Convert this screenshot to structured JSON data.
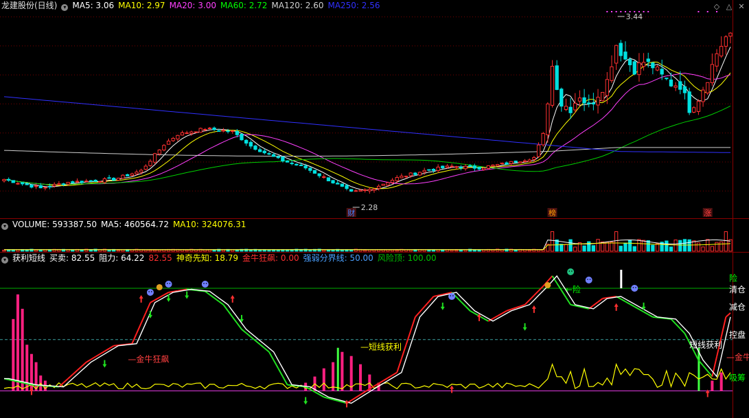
{
  "window": {
    "title": "龙建股份(日线)",
    "icons": [
      "diamond-icon",
      "up-arrow-icon",
      "close-icon"
    ]
  },
  "main_panel": {
    "ma_items": [
      {
        "label": "MA5: 3.06",
        "color": "#ffffff"
      },
      {
        "label": "MA10: 2.97",
        "color": "#ffff00"
      },
      {
        "label": "MA20: 3.00",
        "color": "#ff40ff"
      },
      {
        "label": "MA60: 2.72",
        "color": "#00ff00"
      },
      {
        "label": "MA120: 2.60",
        "color": "#d0d0d0"
      },
      {
        "label": "MA250: 2.56",
        "color": "#3030ff"
      }
    ],
    "high_label": "3.44",
    "low_label": "2.28",
    "markers": [
      {
        "text": "财",
        "color": "#4080ff"
      },
      {
        "text": "榜",
        "color": "#ffa000"
      },
      {
        "text": "涨",
        "color": "#ff4040"
      }
    ]
  },
  "volume_panel": {
    "items": [
      {
        "label": "VOLUME: 593387.50",
        "color": "#ffffff"
      },
      {
        "label": "MA5: 460564.72",
        "color": "#ffffff"
      },
      {
        "label": "MA10: 324076.31",
        "color": "#ffff00"
      }
    ]
  },
  "indicator_panel": {
    "items": [
      {
        "label": "获利短线",
        "color": "#ffffff"
      },
      {
        "label": "买卖: 82.55",
        "color": "#ffffff"
      },
      {
        "label": "阻力: 64.22",
        "color": "#ffffff"
      },
      {
        "label": "82.55",
        "color": "#ff3030"
      },
      {
        "label": "神奇先知: 18.79",
        "color": "#ffff00"
      },
      {
        "label": "金牛狂飙: 0.00",
        "color": "#ff3030"
      },
      {
        "label": "强弱分界线: 50.00",
        "color": "#4aa0ff"
      },
      {
        "label": "风险顶: 100.00",
        "color": "#00c000"
      }
    ],
    "annotations": {
      "jinniu": "金牛狂飙",
      "duanxian1": "短线获利",
      "duanxian2": "短线获利",
      "jinniu_right": "金牛",
      "xian_right": "险",
      "xian_mid": "险",
      "qingcang": "清仓",
      "jiancang": "减仓",
      "kongpan": "控盘",
      "xichou": "吸筹"
    }
  },
  "chart_data": {
    "type": "candlestick",
    "title": "龙建股份(日线)",
    "n_bars": 160,
    "ylim": [
      2.15,
      3.55
    ],
    "price_key_points": [
      [
        0,
        2.38
      ],
      [
        8,
        2.32
      ],
      [
        14,
        2.36
      ],
      [
        24,
        2.38
      ],
      [
        30,
        2.44
      ],
      [
        35,
        2.62
      ],
      [
        38,
        2.69
      ],
      [
        44,
        2.73
      ],
      [
        50,
        2.71
      ],
      [
        54,
        2.61
      ],
      [
        60,
        2.52
      ],
      [
        66,
        2.46
      ],
      [
        72,
        2.36
      ],
      [
        76,
        2.29
      ],
      [
        80,
        2.31
      ],
      [
        86,
        2.39
      ],
      [
        92,
        2.44
      ],
      [
        98,
        2.47
      ],
      [
        104,
        2.46
      ],
      [
        110,
        2.49
      ],
      [
        116,
        2.53
      ],
      [
        118,
        2.69
      ],
      [
        120,
        3.16
      ],
      [
        122,
        2.9
      ],
      [
        124,
        2.87
      ],
      [
        126,
        2.96
      ],
      [
        128,
        2.88
      ],
      [
        130,
        2.97
      ],
      [
        132,
        3.06
      ],
      [
        134,
        3.31
      ],
      [
        136,
        3.21
      ],
      [
        138,
        3.14
      ],
      [
        140,
        3.19
      ],
      [
        142,
        3.16
      ],
      [
        144,
        3.09
      ],
      [
        146,
        3.04
      ],
      [
        148,
        3.03
      ],
      [
        150,
        2.87
      ],
      [
        152,
        2.94
      ],
      [
        154,
        3.08
      ],
      [
        156,
        3.25
      ],
      [
        158,
        3.36
      ]
    ],
    "series_lines": [
      {
        "name": "MA5",
        "last": 3.06
      },
      {
        "name": "MA10",
        "last": 2.97
      },
      {
        "name": "MA20",
        "last": 3.0
      },
      {
        "name": "MA60",
        "last": 2.72
      },
      {
        "name": "MA120",
        "last": 2.6
      },
      {
        "name": "MA250",
        "last": 2.56
      }
    ],
    "indicator_lines": [
      {
        "name": "买卖",
        "last": 82.55
      },
      {
        "name": "阻力",
        "last": 64.22
      },
      {
        "name": "神奇先知",
        "last": 18.79
      },
      {
        "name": "金牛狂飙",
        "last": 0.0
      },
      {
        "name": "强弱分界线",
        "last": 50.0
      },
      {
        "name": "风险顶",
        "last": 100.0
      }
    ],
    "indicator_key_points": [
      [
        0,
        12
      ],
      [
        6,
        6
      ],
      [
        12,
        4
      ],
      [
        18,
        28
      ],
      [
        24,
        44
      ],
      [
        28,
        46
      ],
      [
        32,
        86
      ],
      [
        36,
        96
      ],
      [
        40,
        99
      ],
      [
        44,
        97
      ],
      [
        48,
        84
      ],
      [
        52,
        60
      ],
      [
        58,
        38
      ],
      [
        62,
        6
      ],
      [
        66,
        4
      ],
      [
        70,
        -6
      ],
      [
        75,
        -12
      ],
      [
        80,
        2
      ],
      [
        86,
        18
      ],
      [
        90,
        72
      ],
      [
        94,
        92
      ],
      [
        98,
        96
      ],
      [
        102,
        78
      ],
      [
        106,
        68
      ],
      [
        110,
        78
      ],
      [
        114,
        84
      ],
      [
        118,
        102
      ],
      [
        120,
        112
      ],
      [
        124,
        84
      ],
      [
        128,
        80
      ],
      [
        131,
        90
      ],
      [
        134,
        92
      ],
      [
        138,
        82
      ],
      [
        142,
        72
      ],
      [
        146,
        70
      ],
      [
        149,
        56
      ],
      [
        152,
        30
      ],
      [
        155,
        14
      ],
      [
        158,
        72
      ],
      [
        160,
        80
      ]
    ]
  }
}
